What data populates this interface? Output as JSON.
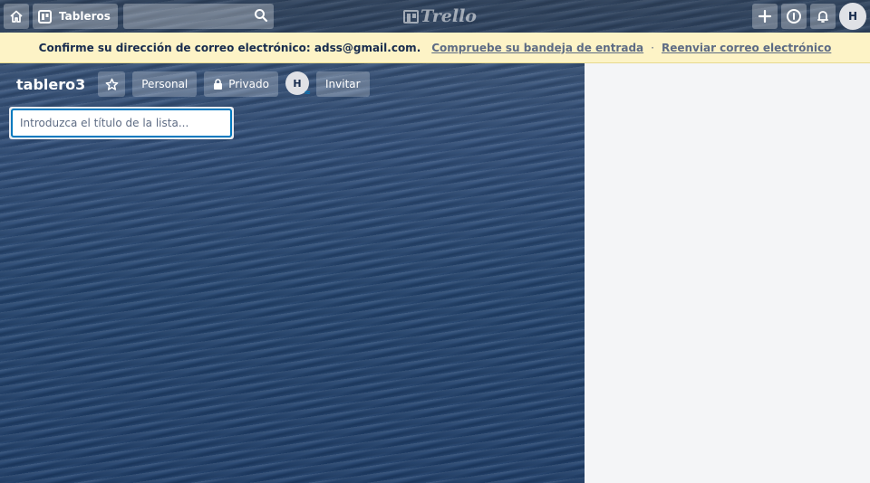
{
  "header": {
    "boards_label": "Tableros",
    "logo_text": "Trello",
    "avatar_initial": "H",
    "icons": {
      "home": "home-icon",
      "boards": "boards-icon",
      "search": "search-icon",
      "create": "plus-icon",
      "info": "info-icon",
      "notifications": "bell-icon"
    }
  },
  "banner": {
    "message": "Confirme su dirección de correo electrónico: adss@gmail.com.",
    "check_inbox_link": "Compruebe su bandeja de entrada",
    "separator": "·",
    "resend_link": "Reenviar correo electrónico",
    "background_color": "#fdf3c6"
  },
  "board": {
    "title": "tablero3",
    "team_label": "Personal",
    "visibility_label": "Privado",
    "member_initial": "H",
    "invite_label": "Invitar"
  },
  "add_list": {
    "placeholder": "Introduzca el título de la lista...",
    "value": "",
    "border_color": "#0079bf"
  },
  "colors": {
    "accent": "#0079bf",
    "panel_bg": "#f4f5f7"
  }
}
